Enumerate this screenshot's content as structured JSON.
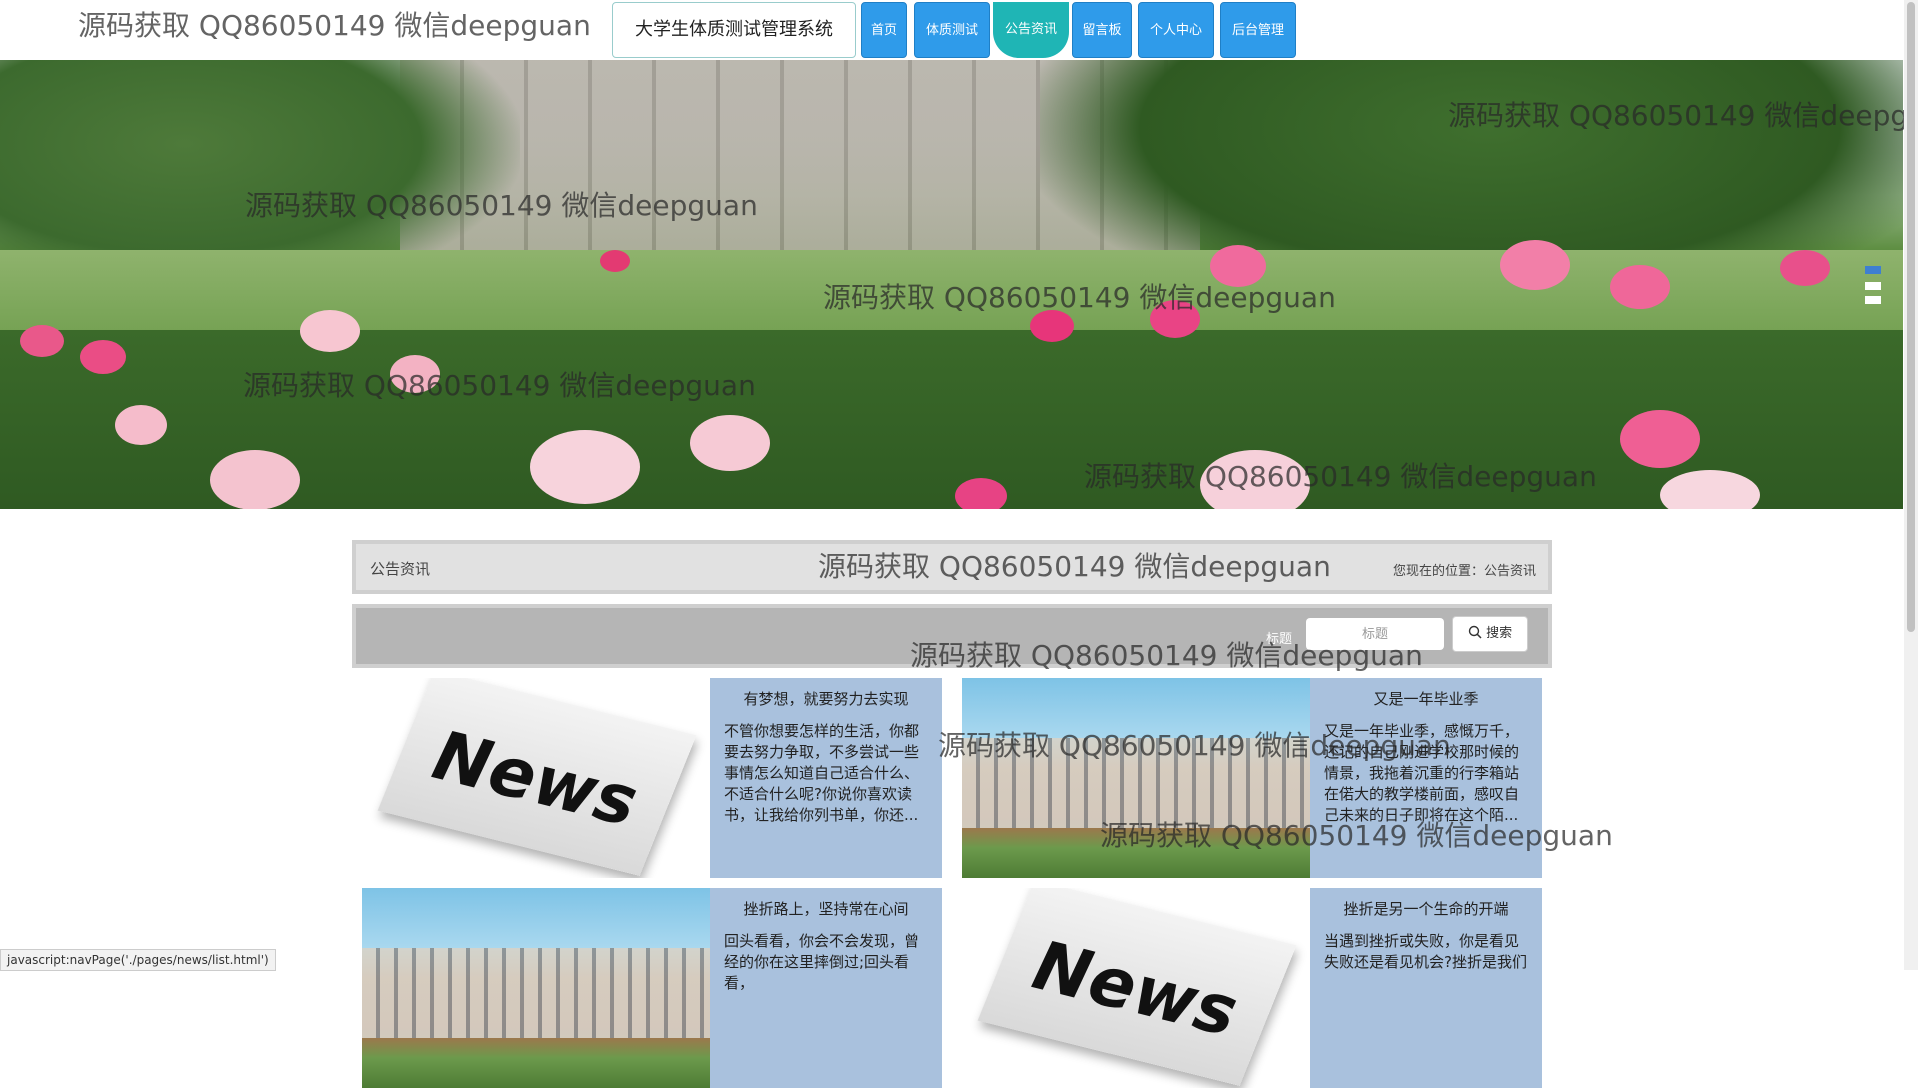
{
  "header": {
    "site_title": "大学生体质测试管理系统",
    "nav": [
      {
        "label": "首页",
        "active": false
      },
      {
        "label": "体质测试",
        "active": false
      },
      {
        "label": "公告资讯",
        "active": true
      },
      {
        "label": "留言板",
        "active": false
      },
      {
        "label": "个人中心",
        "active": false
      },
      {
        "label": "后台管理",
        "active": false
      }
    ]
  },
  "breadcrumb": {
    "title": "公告资讯",
    "location": "您现在的位置：公告资讯"
  },
  "search": {
    "label": "标题",
    "placeholder": "标题",
    "button_label": "搜索"
  },
  "news": [
    {
      "title": "有梦想，就要努力去实现",
      "summary": "不管你想要怎样的生活，你都要去努力争取，不多尝试一些事情怎么知道自己适合什么、不适合什么呢?你说你喜欢读书，让我给你列书单，你还...",
      "image": "news"
    },
    {
      "title": "又是一年毕业季",
      "summary": "又是一年毕业季，感慨万千，还记的自己刚进学校那时候的情景，我拖着沉重的行李箱站在偌大的教学楼前面，感叹自己未来的日子即将在这个陌...",
      "image": "campus"
    },
    {
      "title": "挫折路上，坚持常在心间",
      "summary": "回头看看，你会不会发现，曾经的你在这里摔倒过;回头看看，",
      "image": "campus"
    },
    {
      "title": "挫折是另一个生命的开端",
      "summary": "当遇到挫折或失败，你是看见失败还是看见机会?挫折是我们",
      "image": "news"
    }
  ],
  "watermark": "源码获取 QQ86050149 微信deepguan",
  "status_bar": "javascript:navPage('./pages/news/list.html')",
  "colors": {
    "nav_button": "#2f9bea",
    "nav_active": "#1fb5b5",
    "card_text_bg": "#a9c1dd"
  }
}
